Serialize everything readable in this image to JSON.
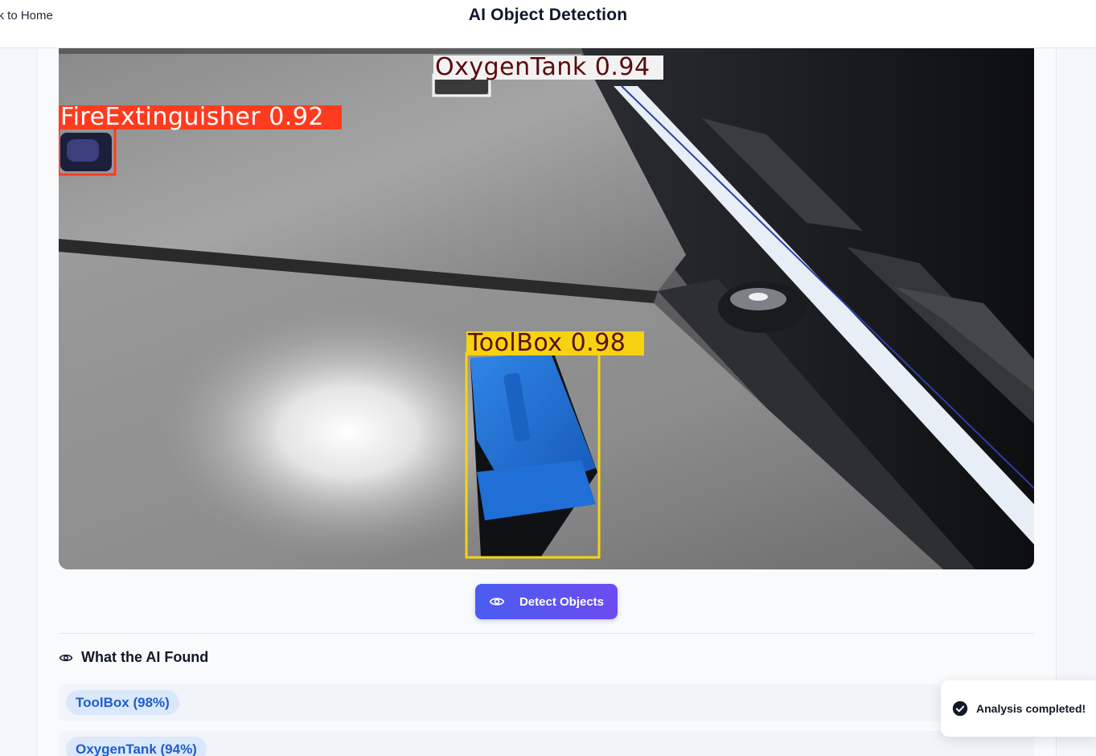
{
  "header": {
    "back_label": "ck to Home",
    "title": "AI Object Detection"
  },
  "detection_image": {
    "detections": [
      {
        "label": "OxygenTank 0.94",
        "class": "OxygenTank",
        "confidence": 0.94,
        "color": "#f2f2f2",
        "text_color": "#5a0a0a"
      },
      {
        "label": "FireExtinguisher 0.92",
        "class": "FireExtinguisher",
        "confidence": 0.92,
        "color": "#ff3b1f",
        "text_color": "#ffffff"
      },
      {
        "label": "ToolBox 0.98",
        "class": "ToolBox",
        "confidence": 0.98,
        "color": "#f5d312",
        "text_color": "#5a1010"
      }
    ]
  },
  "actions": {
    "detect_label": "Detect Objects",
    "detect_icon": "eye-icon",
    "accent": "#5a52f0"
  },
  "results": {
    "heading": "What the AI Found",
    "heading_icon": "eye-icon",
    "items": [
      {
        "label": "ToolBox (98%)"
      },
      {
        "label": "OxygenTank (94%)"
      }
    ]
  },
  "toast": {
    "message": "Analysis completed!",
    "icon": "check-circle-icon"
  }
}
